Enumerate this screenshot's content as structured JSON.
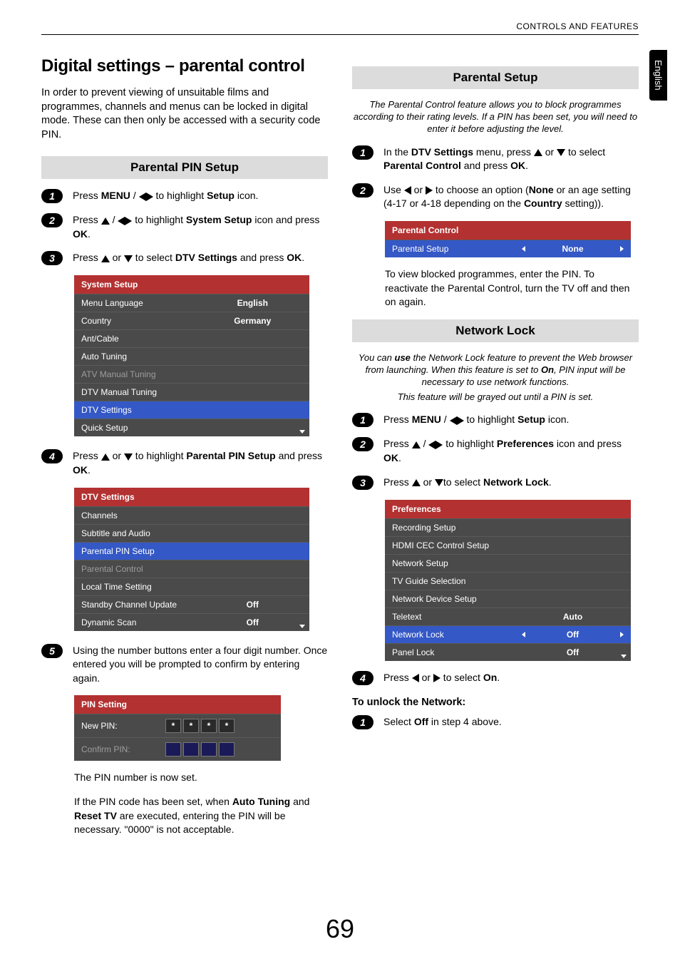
{
  "header": {
    "right": "CONTROLS AND FEATURES"
  },
  "side_tab": "English",
  "page_number": "69",
  "left": {
    "title": "Digital settings – parental control",
    "intro": "In order to prevent viewing of unsuitable films and programmes, channels and menus can be locked in digital mode. These can then only be accessed with a security code PIN.",
    "heading1": "Parental PIN Setup",
    "step1": {
      "pre": "Press ",
      "bold1": "MENU",
      "mid": " / ",
      "post": " to highlight ",
      "bold2": "Setup",
      "tail": " icon."
    },
    "step2": {
      "pre": "Press ",
      "mid": " / ",
      "post": " to highlight ",
      "bold1": "System Setup",
      "tail": " icon and press ",
      "bold2": "OK",
      "end": "."
    },
    "step3": {
      "pre": "Press ",
      "mid": " or ",
      "post": " to select ",
      "bold1": "DTV Settings",
      "tail": " and press ",
      "bold2": "OK",
      "end": "."
    },
    "system_setup_menu": {
      "title": "System Setup",
      "rows": [
        {
          "label": "Menu Language",
          "value": "English"
        },
        {
          "label": "Country",
          "value": "Germany"
        },
        {
          "label": "Ant/Cable",
          "value": ""
        },
        {
          "label": "Auto Tuning",
          "value": ""
        },
        {
          "label": "ATV Manual Tuning",
          "value": "",
          "dim": true
        },
        {
          "label": "DTV Manual Tuning",
          "value": ""
        },
        {
          "label": "DTV Settings",
          "value": "",
          "hl": true
        },
        {
          "label": "Quick Setup",
          "value": ""
        }
      ]
    },
    "step4": {
      "pre": "Press ",
      "mid": " or ",
      "post": " to highlight ",
      "bold1": "Parental PIN Setup",
      "tail": " and press ",
      "bold2": "OK",
      "end": "."
    },
    "dtv_settings_menu": {
      "title": "DTV Settings",
      "rows": [
        {
          "label": "Channels",
          "value": ""
        },
        {
          "label": "Subtitle and Audio",
          "value": ""
        },
        {
          "label": "Parental PIN Setup",
          "value": "",
          "hl": true
        },
        {
          "label": "Parental Control",
          "value": "",
          "dim": true
        },
        {
          "label": "Local Time Setting",
          "value": ""
        },
        {
          "label": "Standby Channel Update",
          "value": "Off"
        },
        {
          "label": "Dynamic Scan",
          "value": "Off"
        }
      ]
    },
    "step5": "Using the number buttons enter a four digit number. Once entered you will be prompted to confirm by entering again.",
    "pin_menu": {
      "title": "PIN Setting",
      "row1_label": "New PIN:",
      "row2_label": "Confirm PIN:",
      "cells": [
        "*",
        "*",
        "*",
        "*"
      ]
    },
    "after_pin1": "The PIN number is now set.",
    "after_pin2_pre": "If the PIN code has been set, when ",
    "after_pin2_b1": "Auto Tuning",
    "after_pin2_mid": " and ",
    "after_pin2_b2": "Reset TV",
    "after_pin2_post": " are executed, entering the PIN will be necessary. \"0000\" is not acceptable."
  },
  "right": {
    "heading1": "Parental Setup",
    "intro1": "The Parental Control feature allows you to block programmes according to their rating levels. If a PIN has been set, you will need to enter it before adjusting the level.",
    "step1": {
      "pre": "In the ",
      "bold1": "DTV Settings",
      "mid": " menu, press ",
      "mid2": " or ",
      "post": " to select ",
      "bold2": "Parental Control",
      "tail": " and press ",
      "bold3": "OK",
      "end": "."
    },
    "step2": {
      "pre": "Use ",
      "mid": " or ",
      "post": " to choose an option (",
      "bold1": "None",
      "mid2": " or an age setting (4-17 or 4-18 depending on the ",
      "bold2": "Country",
      "tail": " setting))."
    },
    "parental_menu": {
      "title": "Parental Control",
      "row": {
        "label": "Parental Setup",
        "value": "None"
      }
    },
    "after1": "To view blocked programmes, enter the PIN. To reactivate the Parental Control, turn the TV off and then on again.",
    "heading2": "Network Lock",
    "intro2_pre": "You can ",
    "intro2_b1": "use",
    "intro2_mid": " the Network Lock feature to prevent the Web browser from launching. When this feature is set to ",
    "intro2_b2": "On",
    "intro2_post": ", PIN input will be necessary to use network functions.",
    "intro2_line2": "This feature will be grayed out until a PIN is set.",
    "nstep1": {
      "pre": "Press ",
      "bold1": "MENU",
      "mid": " / ",
      "post": " to highlight ",
      "bold2": "Setup",
      "tail": " icon."
    },
    "nstep2": {
      "pre": "Press ",
      "mid": " / ",
      "post": " to highlight ",
      "bold1": "Preferences",
      "tail": " icon and press ",
      "bold2": "OK",
      "end": "."
    },
    "nstep3": {
      "pre": "Press ",
      "mid": " or ",
      "post": "to select ",
      "bold1": "Network Lock",
      "end": "."
    },
    "prefs_menu": {
      "title": "Preferences",
      "rows": [
        {
          "label": "Recording Setup",
          "value": ""
        },
        {
          "label": "HDMI CEC Control Setup",
          "value": ""
        },
        {
          "label": "Network Setup",
          "value": ""
        },
        {
          "label": "TV Guide Selection",
          "value": ""
        },
        {
          "label": "Network Device Setup",
          "value": ""
        },
        {
          "label": "Teletext",
          "value": "Auto"
        },
        {
          "label": "Network Lock",
          "value": "Off",
          "hl": true,
          "arrows": true
        },
        {
          "label": "Panel Lock",
          "value": "Off"
        }
      ]
    },
    "nstep4": {
      "pre": "Press ",
      "mid": " or ",
      "post": " to select ",
      "bold1": "On",
      "end": "."
    },
    "unlock_heading": "To unlock the Network:",
    "unlock_step": {
      "pre": "Select ",
      "bold1": "Off",
      "post": " in step 4 above."
    }
  }
}
